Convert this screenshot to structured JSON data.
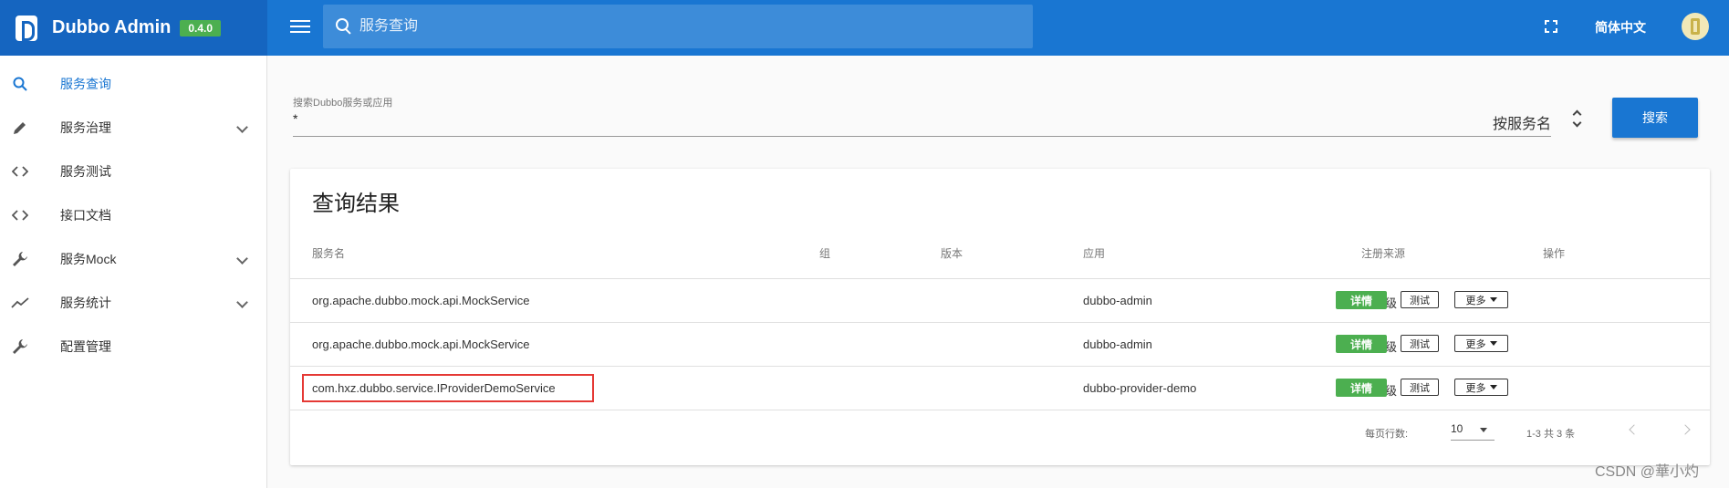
{
  "header": {
    "brand": "Dubbo Admin",
    "version": "0.4.0",
    "search_placeholder": "服务查询",
    "language": "简体中文"
  },
  "sidebar": {
    "items": [
      {
        "label": "服务查询",
        "icon": "search-icon",
        "active": true,
        "expandable": false
      },
      {
        "label": "服务治理",
        "icon": "pencil-icon",
        "active": false,
        "expandable": true
      },
      {
        "label": "服务测试",
        "icon": "code-icon",
        "active": false,
        "expandable": false
      },
      {
        "label": "接口文档",
        "icon": "code-icon",
        "active": false,
        "expandable": false
      },
      {
        "label": "服务Mock",
        "icon": "wrench-icon",
        "active": false,
        "expandable": true
      },
      {
        "label": "服务统计",
        "icon": "trending-icon",
        "active": false,
        "expandable": true
      },
      {
        "label": "配置管理",
        "icon": "wrench-icon",
        "active": false,
        "expandable": false
      }
    ]
  },
  "search": {
    "field_label": "搜索Dubbo服务或应用",
    "field_value": "*",
    "search_by": "按服务名",
    "button": "搜索"
  },
  "results": {
    "title": "查询结果",
    "columns": [
      "服务名",
      "组",
      "版本",
      "应用",
      "注册来源",
      "操作"
    ],
    "rows": [
      {
        "service": "org.apache.dubbo.mock.api.MockService",
        "group": "",
        "version": "",
        "app": "dubbo-admin",
        "source": "接口级",
        "highlighted": false
      },
      {
        "service": "org.apache.dubbo.mock.api.MockService",
        "group": "",
        "version": "",
        "app": "dubbo-admin",
        "source": "应用级",
        "highlighted": false
      },
      {
        "service": "com.hxz.dubbo.service.IProviderDemoService",
        "group": "",
        "version": "",
        "app": "dubbo-provider-demo",
        "source": "应用级",
        "highlighted": true
      }
    ],
    "actions": {
      "detail": "详情",
      "test": "测试",
      "more": "更多"
    },
    "footer": {
      "rows_per_page_label": "每页行数:",
      "rows_per_page": "10",
      "range": "1-3 共 3 条"
    }
  },
  "watermark": "CSDN @華小灼",
  "colors": {
    "primary": "#1976d2",
    "brand_bg": "#1565c0",
    "success": "#4caf50",
    "highlight": "#e53935"
  }
}
